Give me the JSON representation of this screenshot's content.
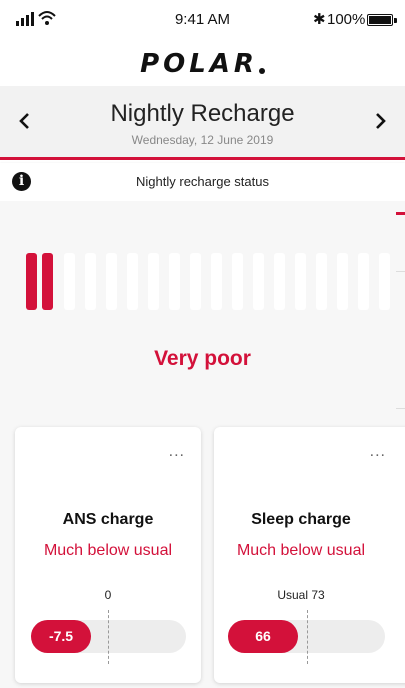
{
  "status_bar": {
    "time": "9:41 AM",
    "battery": "100%",
    "icons": [
      "signal-icon",
      "wifi-icon",
      "bluetooth-icon",
      "battery-icon"
    ]
  },
  "brand": {
    "logo": "POLAR"
  },
  "header": {
    "title": "Nightly Recharge",
    "date": "Wednesday, 12 June 2019",
    "prev_icon": "<",
    "next_icon": ">"
  },
  "status_row": {
    "icon": "i",
    "label": "Nightly recharge status"
  },
  "recharge_scale": {
    "total_bars": 18,
    "filled_bars": 2,
    "status_text": "Very poor"
  },
  "cards": [
    {
      "more": "...",
      "title": "ANS charge",
      "subtitle": "Much below usual",
      "reference_label": "0",
      "value": "-7.5"
    },
    {
      "more": "...",
      "title": "Sleep charge",
      "subtitle": "Much below usual",
      "reference_label": "Usual 73",
      "value": "66"
    }
  ],
  "colors": {
    "accent": "#d3113a",
    "header_bg": "#f2f2f2",
    "content_bg": "#f7f7f7"
  }
}
